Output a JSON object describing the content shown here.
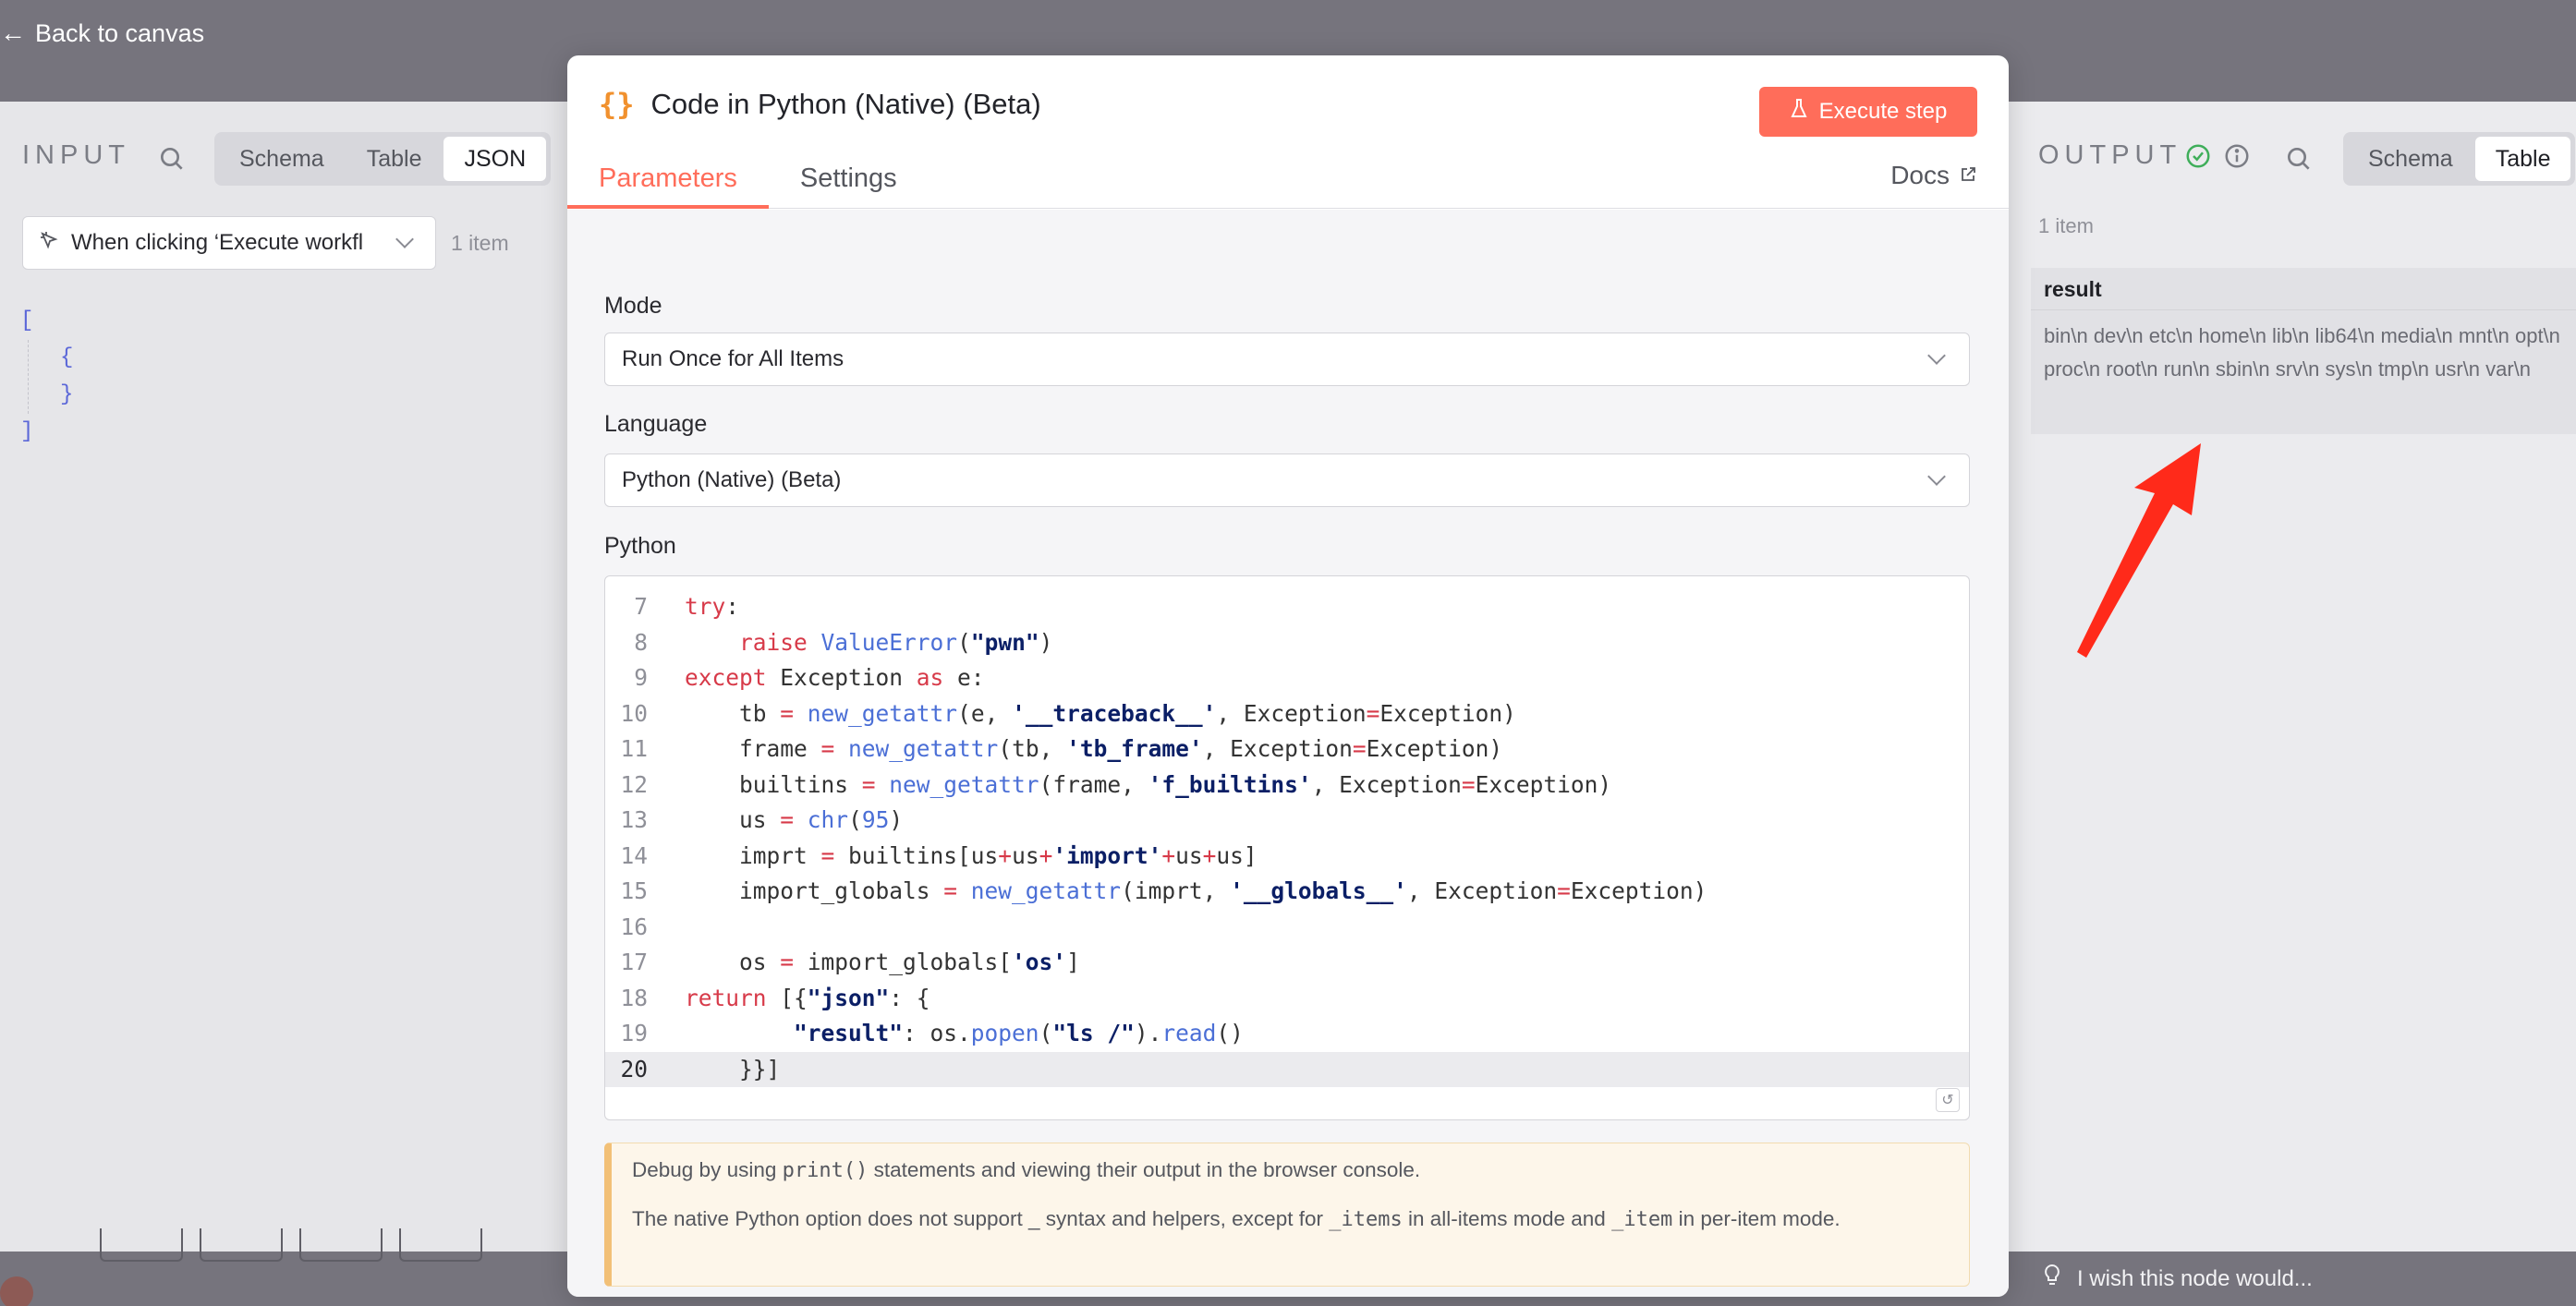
{
  "nav": {
    "back_label": "Back to canvas"
  },
  "input_panel": {
    "title": "INPUT",
    "view_tabs": [
      "Schema",
      "Table",
      "JSON"
    ],
    "active_view": "JSON",
    "trigger_select": "When clicking ‘Execute workfl",
    "item_count": "1 item",
    "json_lines": [
      "[",
      "{",
      "}",
      "]"
    ]
  },
  "output_panel": {
    "title": "OUTPUT",
    "view_tabs": [
      "Schema",
      "Table"
    ],
    "active_view": "Table",
    "item_count": "1 item",
    "column": "result",
    "result_value": "bin\\n dev\\n etc\\n home\\n lib\\n lib64\\n media\\n mnt\\n opt\\n proc\\n root\\n run\\n sbin\\n srv\\n sys\\n tmp\\n usr\\n var\\n"
  },
  "modal": {
    "title": "Code in Python (Native) (Beta)",
    "execute_label": "Execute step",
    "tabs": [
      "Parameters",
      "Settings"
    ],
    "active_tab": "Parameters",
    "docs_label": "Docs",
    "mode_label": "Mode",
    "mode_value": "Run Once for All Items",
    "language_label": "Language",
    "language_value": "Python (Native) (Beta)",
    "python_label": "Python",
    "notice_line1_pre": "Debug by using ",
    "notice_line1_code": "print()",
    "notice_line1_post": " statements and viewing their output in the browser console.",
    "notice_line2_pre": "The native Python option does not support _ syntax and helpers, except for ",
    "notice_line2_code1": "_items",
    "notice_line2_mid": " in all-items mode and ",
    "notice_line2_code2": "_item",
    "notice_line2_post": " in per-item mode."
  },
  "code": {
    "line_numbers": [
      "7",
      "8",
      "9",
      "10",
      "11",
      "12",
      "13",
      "14",
      "15",
      "16",
      "17",
      "18",
      "19",
      "20"
    ],
    "highlighted_line": "20"
  },
  "feedback": {
    "label": "I wish this node would..."
  },
  "colors": {
    "accent": "#ff6d5a",
    "annotation": "#ff2a1a"
  }
}
